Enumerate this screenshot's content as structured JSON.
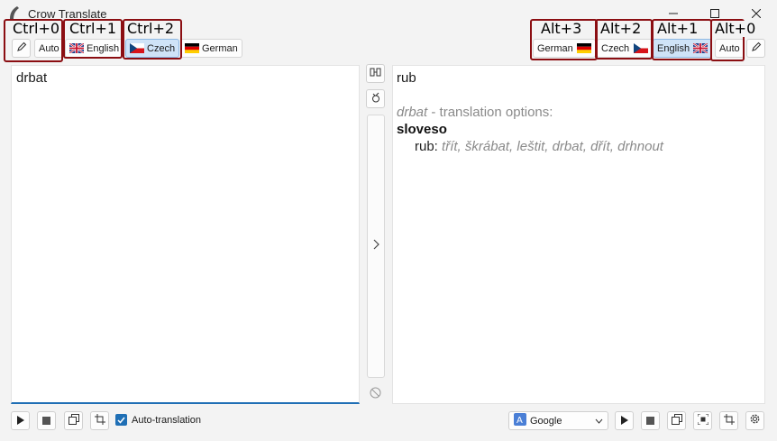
{
  "window": {
    "title": "Crow Translate"
  },
  "source_languages": [
    {
      "label": "Auto",
      "hotkey": "Ctrl+0",
      "active": false,
      "flag": ""
    },
    {
      "label": "English",
      "hotkey": "Ctrl+1",
      "active": false,
      "flag": "uk"
    },
    {
      "label": "Czech",
      "hotkey": "Ctrl+2",
      "active": true,
      "flag": "cz"
    },
    {
      "label": "German",
      "hotkey": "",
      "active": false,
      "flag": "de"
    }
  ],
  "translation_languages": [
    {
      "label": "German",
      "hotkey": "Alt+3",
      "active": false,
      "flag": "de"
    },
    {
      "label": "Czech",
      "hotkey": "Alt+2",
      "active": false,
      "flag": "cz"
    },
    {
      "label": "English",
      "hotkey": "Alt+1",
      "active": true,
      "flag": "uk"
    },
    {
      "label": "Auto",
      "hotkey": "Alt+0",
      "active": false,
      "flag": ""
    }
  ],
  "source": {
    "text": "drbat"
  },
  "result": {
    "translation": "rub",
    "options_word": "drbat",
    "options_suffix": " - translation options:",
    "part_of_speech": "sloveso",
    "entry_word": "rub:",
    "synonyms": "třít, škrábat, leštit, drbat, dřít, drhnout"
  },
  "bottom": {
    "auto_translation_label": "Auto-translation",
    "auto_translation_checked": true,
    "engine": "Google"
  },
  "colors": {
    "accent": "#1f6fb5",
    "hotkey_box": "#8b0e12",
    "active_lang": "#cfe3f7"
  }
}
